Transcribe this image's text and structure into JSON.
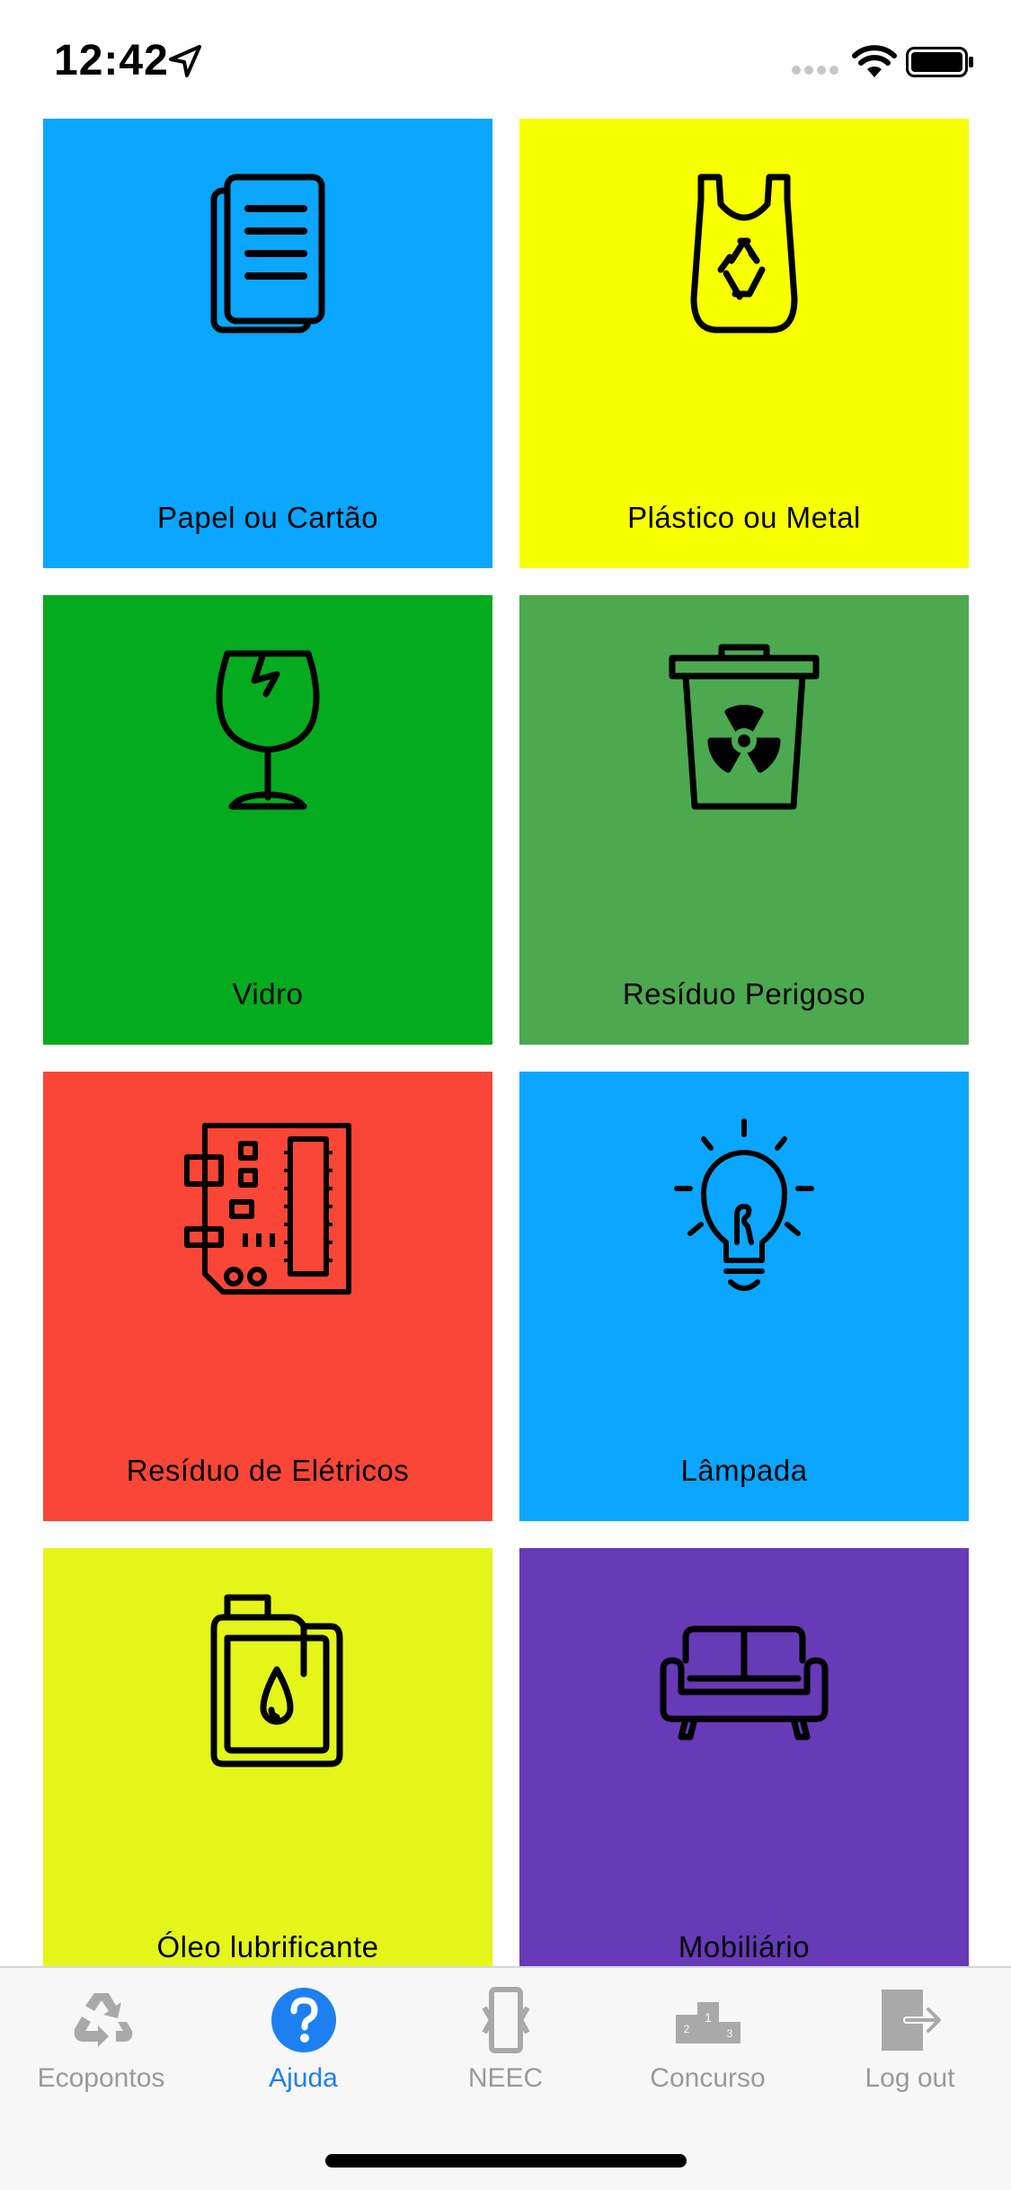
{
  "status_bar": {
    "time": "12:42"
  },
  "categories": [
    {
      "label": "Papel ou Cartão",
      "icon": "paper-documents-icon",
      "color": "#0aa6ff"
    },
    {
      "label": "Plástico ou Metal",
      "icon": "plastic-bag-recycle-icon",
      "color": "#f7ff00"
    },
    {
      "label": "Vidro",
      "icon": "broken-glass-icon",
      "color": "#05ab1e"
    },
    {
      "label": "Resíduo Perigoso",
      "icon": "hazardous-bin-icon",
      "color": "#4ca94f"
    },
    {
      "label": "Resíduo de Elétricos",
      "icon": "circuit-board-icon",
      "color": "#fa4637"
    },
    {
      "label": "Lâmpada",
      "icon": "light-bulb-icon",
      "color": "#0aa6ff"
    },
    {
      "label": "Óleo lubrificante",
      "icon": "oil-canister-icon",
      "color": "#e4f51a"
    },
    {
      "label": "Mobiliário",
      "icon": "sofa-icon",
      "color": "#673ab7"
    }
  ],
  "tabs": [
    {
      "label": "Ecopontos",
      "icon": "recycle-icon",
      "active": false
    },
    {
      "label": "Ajuda",
      "icon": "help-question-icon",
      "active": true
    },
    {
      "label": "NEEC",
      "icon": "phone-icon",
      "active": false
    },
    {
      "label": "Concurso",
      "icon": "podium-icon",
      "active": false
    },
    {
      "label": "Log out",
      "icon": "logout-icon",
      "active": false
    }
  ]
}
